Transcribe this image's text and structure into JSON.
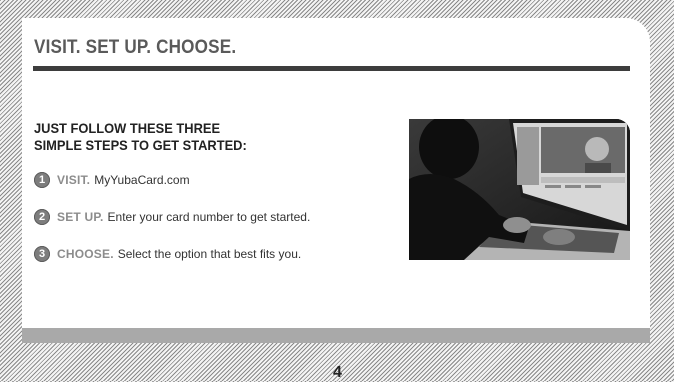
{
  "heading": "VISIT. SET UP. CHOOSE.",
  "subheading_line1": "JUST FOLLOW THESE THREE",
  "subheading_line2": "SIMPLE STEPS TO GET STARTED:",
  "steps": [
    {
      "number": "1",
      "keyword": "VISIT.",
      "text": "MyYubaCard.com"
    },
    {
      "number": "2",
      "keyword": "SET UP.",
      "text": "Enter your card number to get started."
    },
    {
      "number": "3",
      "keyword": "CHOOSE.",
      "text": "Select the option that best fits you."
    }
  ],
  "page_number": "4",
  "colors": {
    "rule": "#3d3d3d",
    "footer_band": "#a9a9a9",
    "badge": "#7d7d7d",
    "step_keyword": "#8c8c8c"
  }
}
